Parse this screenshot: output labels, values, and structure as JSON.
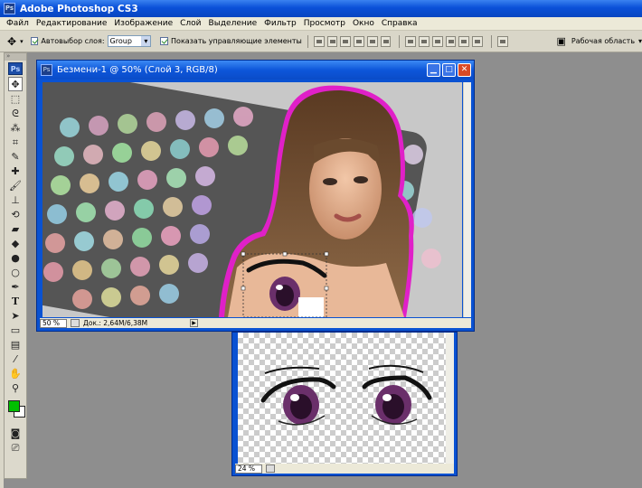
{
  "app": {
    "title": "Adobe Photoshop CS3",
    "icon": "ps-icon"
  },
  "menu": [
    "Файл",
    "Редактирование",
    "Изображение",
    "Слой",
    "Выделение",
    "Фильтр",
    "Просмотр",
    "Окно",
    "Справка"
  ],
  "options": {
    "auto_select_label": "Автовыбор слоя:",
    "auto_select_value": "Group",
    "show_controls_label": "Показать управляющие элементы",
    "workspace_label": "Рабочая область"
  },
  "toolbox": {
    "logo": "Ps"
  },
  "document1": {
    "title": "Безмени-1 @ 50% (Слой 3, RGB/8)",
    "zoom": "50 %",
    "doc_size": "Док.: 2,64M/6,38M"
  },
  "document2": {
    "zoom": "24 %"
  },
  "colors": {
    "foreground": "#00c000",
    "background": "#ffffff",
    "accent": "#0a52d2",
    "selection_outline": "#e018c8"
  }
}
